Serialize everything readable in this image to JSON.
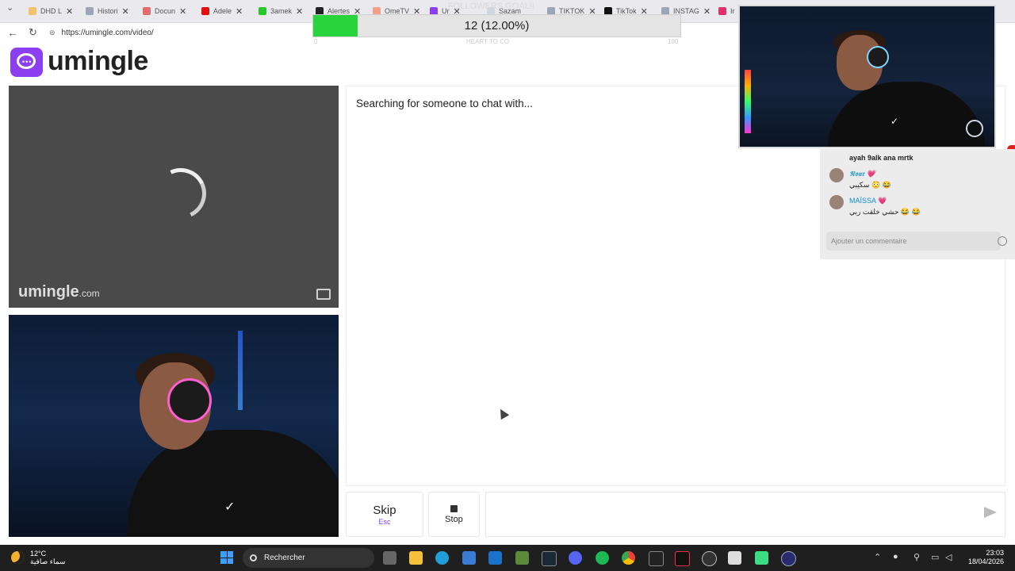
{
  "browser": {
    "tabs": [
      {
        "label": "DHD L"
      },
      {
        "label": "Histori"
      },
      {
        "label": "Docun"
      },
      {
        "label": "Adele"
      },
      {
        "label": "3amek"
      },
      {
        "label": "Alertes"
      },
      {
        "label": "OmeTV"
      },
      {
        "label": "Ur"
      },
      {
        "label": "Sazam"
      },
      {
        "label": "TIKTOK"
      },
      {
        "label": "TikTok"
      },
      {
        "label": "INSTAG"
      },
      {
        "label": "Ir"
      }
    ],
    "url": "https://umingle.com/video/"
  },
  "overlay": {
    "progress_label": "12 (12.00%)",
    "progress_fraction": 0.12,
    "faint_title": "FOLLOWERS GOAL!!",
    "faint_sub": "HEART TO CO",
    "faint_left": "0",
    "faint_right": "100"
  },
  "site": {
    "logo_text": "umingle",
    "watermark": "umingle",
    "watermark_tld": ".com",
    "status_text": "Searching for someone to chat with...",
    "skip_label": "Skip",
    "skip_hint": "Esc",
    "stop_label": "Stop",
    "message_placeholder": ""
  },
  "stream_chat": {
    "messages": [
      {
        "user": "",
        "text": "ayah 9alk ana mrtk"
      },
      {
        "user": "𝕹𝖔𝖚𝖗 💗",
        "text": "سكيبي 😳 😂"
      },
      {
        "user": "MAÏSSA 💗",
        "text": "حشي خلقت ربي 😂 😂"
      }
    ],
    "comment_placeholder": "Ajouter un commentaire"
  },
  "taskbar": {
    "temperature": "12°C",
    "weather_text": "سماء صافية",
    "search_label": "Rechercher",
    "time": "23:03",
    "date": "18/04/2026",
    "app_icons": [
      "task-view",
      "file-explorer",
      "edge",
      "store",
      "outlook",
      "minecraft",
      "steam",
      "discord",
      "spotify",
      "chrome",
      "capcut",
      "tiktok",
      "obs",
      "notepad",
      "android",
      "app-circle"
    ]
  },
  "colors": {
    "brand": "#8b3ff0",
    "progress_fill": "#27d43b",
    "video_bg": "#4a4a4a"
  }
}
